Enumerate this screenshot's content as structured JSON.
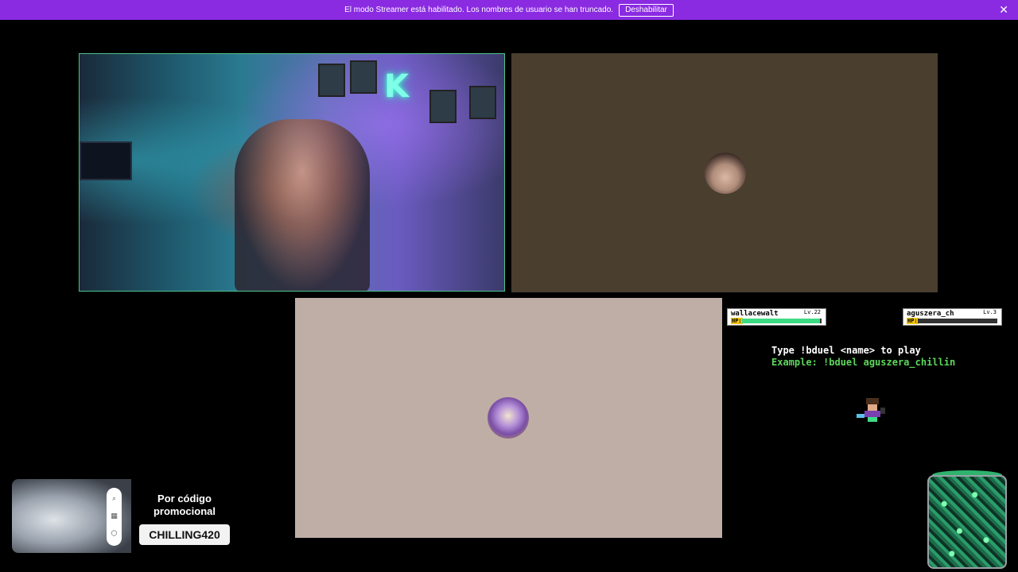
{
  "banner": {
    "message": "El modo Streamer está habilitado. Los nombres de usuario se han truncado.",
    "button_label": "Deshabilitar",
    "close_glyph": "✕",
    "color": "#8a2be2"
  },
  "tiles": [
    {
      "id": "tile-1",
      "type": "live-camera",
      "active_border_color": "#4ec38b"
    },
    {
      "id": "tile-2",
      "type": "avatar-placeholder",
      "background": "#4a3e2f",
      "avatar_icon": "user-avatar"
    },
    {
      "id": "tile-3",
      "type": "avatar-placeholder",
      "background": "#bfaea6",
      "avatar_icon": "user-avatar"
    }
  ],
  "duel": {
    "players": [
      {
        "name": "wallacewalt",
        "level": "Lv.22",
        "hp_label": "HP:",
        "hp_fraction": 0.98
      },
      {
        "name": "aguszera_ch",
        "level": "Lv.3",
        "hp_label": "HP:",
        "hp_fraction": 0.0
      }
    ],
    "instruction": "Type !bduel <name> to play",
    "example": "Example: !bduel aguszera_chillin"
  },
  "promo": {
    "title": "Por código promocional",
    "code": "CHILLING420",
    "icons": [
      "search-icon",
      "gift-icon",
      "tag-icon"
    ],
    "icon_glyphs": [
      "⌕",
      "▦",
      "⬡"
    ]
  }
}
